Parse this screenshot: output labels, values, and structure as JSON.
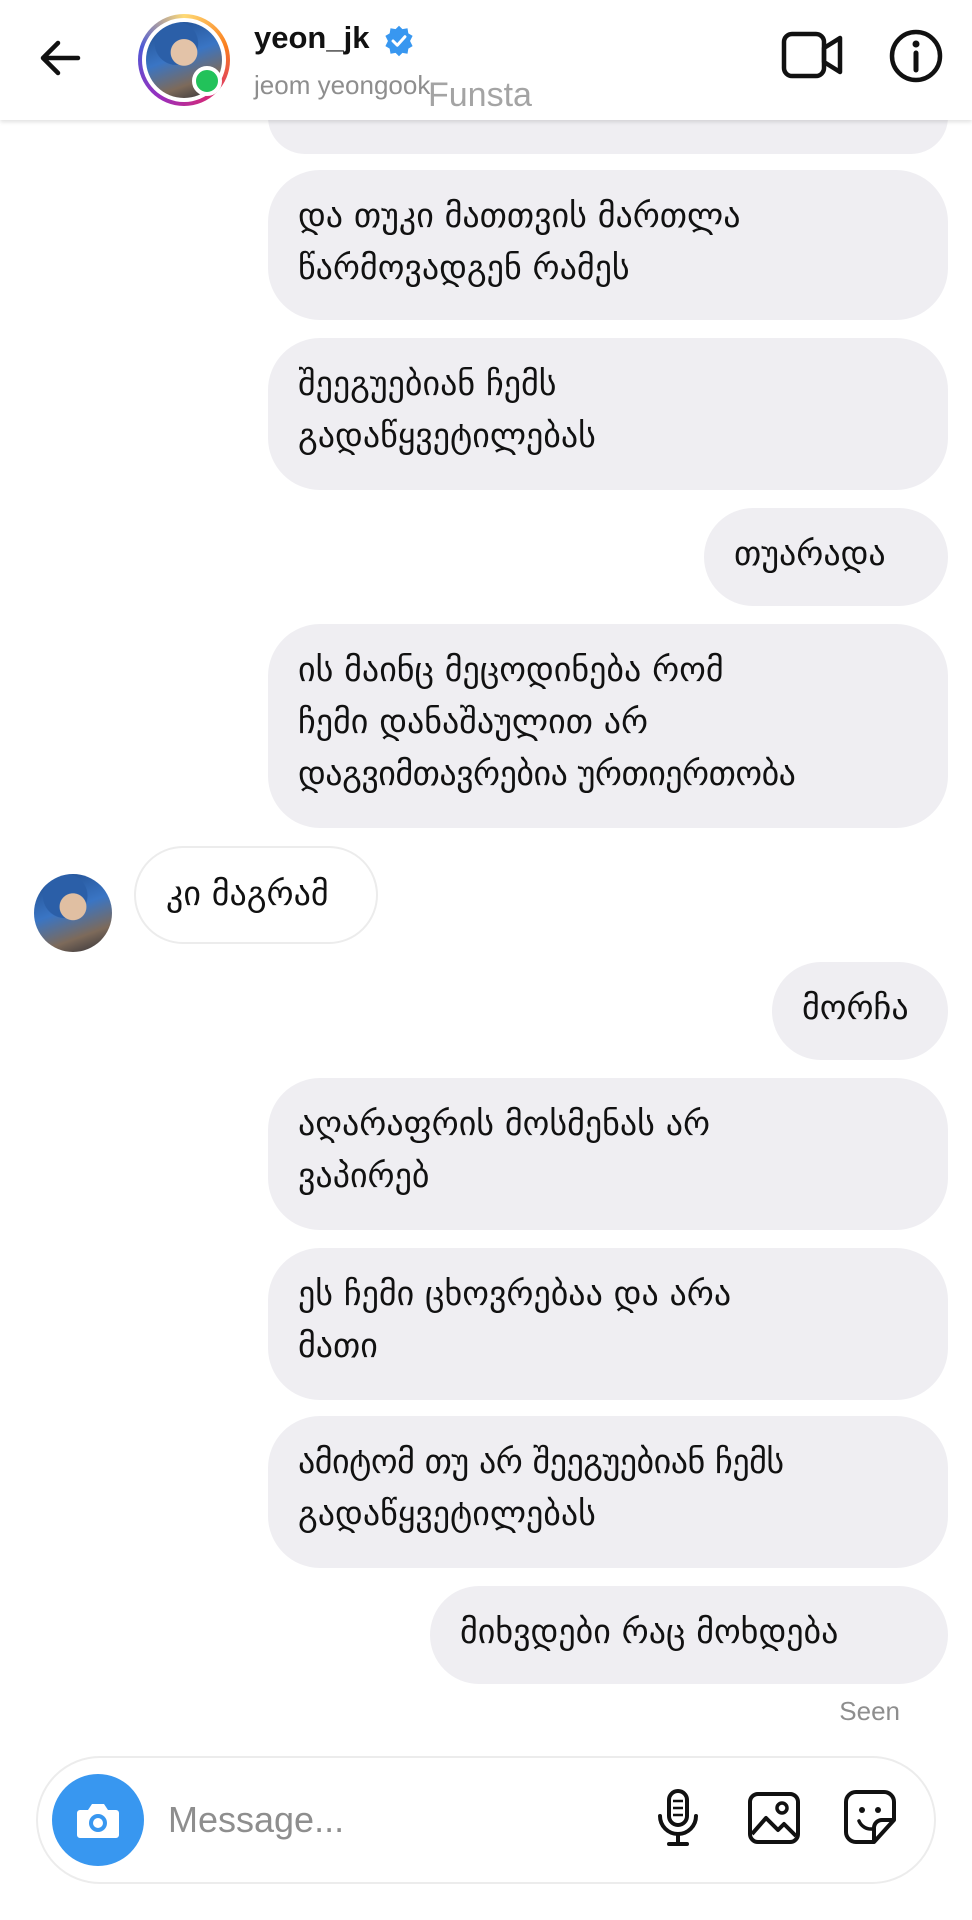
{
  "header": {
    "username": "yeon_jk",
    "subname": "jeom yeongook",
    "watermark": "Funsta",
    "verified": true,
    "online": true
  },
  "messages": [
    {
      "from": "me",
      "lines": [
        "და თუკი მათთვის მართლა",
        "წარმოვადგენ რამეს"
      ]
    },
    {
      "from": "me",
      "lines": [
        "შეეგუებიან ჩემს",
        "გადაწყვეტილებას"
      ]
    },
    {
      "from": "me",
      "lines": [
        "თუარადა"
      ]
    },
    {
      "from": "me",
      "lines": [
        "ის მაინც მეცოდინება რომ",
        "ჩემი დანაშაულით არ",
        "დაგვიმთავრებია ურთიერთობა"
      ]
    },
    {
      "from": "them",
      "lines": [
        "კი მაგრამ"
      ]
    },
    {
      "from": "me",
      "lines": [
        "მორჩა"
      ]
    },
    {
      "from": "me",
      "lines": [
        "აღარაფრის მოსმენას არ",
        "ვაპირებ"
      ]
    },
    {
      "from": "me",
      "lines": [
        "ეს ჩემი ცხოვრებაა და არა",
        "მათი"
      ]
    },
    {
      "from": "me",
      "lines": [
        "ამიტომ თუ არ შეეგუებიან ჩემს",
        "გადაწყვეტილებას"
      ]
    },
    {
      "from": "me",
      "lines": [
        "მიხვდები რაც მოხდება"
      ]
    }
  ],
  "status": {
    "seen": "Seen"
  },
  "composer": {
    "placeholder": "Message..."
  },
  "colors": {
    "accent": "#3897f0",
    "verified": "#3897f0",
    "online": "#22c25a",
    "bubble_me": "#efeef2",
    "muted": "#8e8e8e"
  },
  "icons": [
    "back-arrow-icon",
    "verified-badge-icon",
    "video-call-icon",
    "info-icon",
    "camera-icon",
    "microphone-icon",
    "gallery-icon",
    "sticker-icon"
  ]
}
